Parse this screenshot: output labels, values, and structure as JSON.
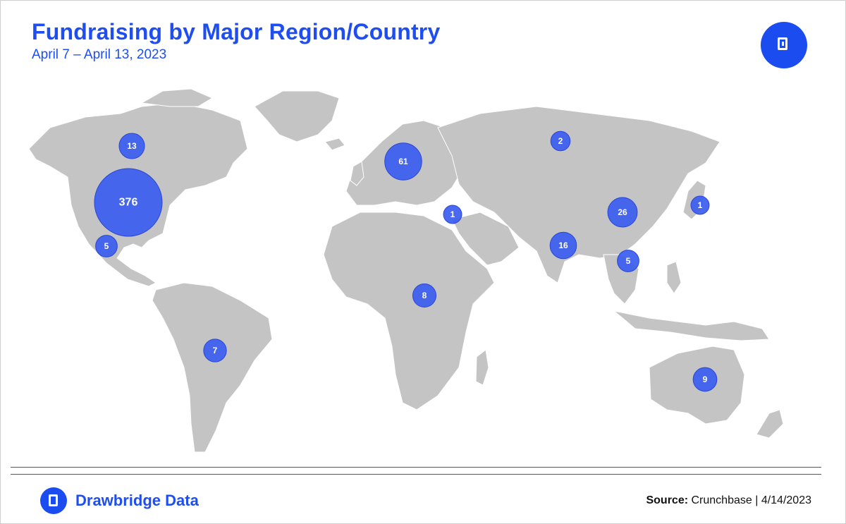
{
  "header": {
    "title": "Fundraising by Major Region/Country",
    "subtitle": "April 7 – April 13, 2023"
  },
  "footer": {
    "brand": "Drawbridge Data",
    "source_label": "Source:",
    "source_text": " Crunchbase | 4/14/2023"
  },
  "colors": {
    "accent": "#1f4ef0",
    "land": "#c4c4c4",
    "bubble": "#3b5cf0"
  },
  "icons": {
    "corner": "drawbridge-logo-icon",
    "brand": "drawbridge-logo-icon"
  },
  "map_data": {
    "type": "bubble-map",
    "bubbles": [
      {
        "region": "Canada",
        "value": 13
      },
      {
        "region": "United States",
        "value": 376
      },
      {
        "region": "Mexico",
        "value": 5
      },
      {
        "region": "Brazil",
        "value": 7
      },
      {
        "region": "Europe",
        "value": 61
      },
      {
        "region": "Russia",
        "value": 2
      },
      {
        "region": "Israel",
        "value": 1
      },
      {
        "region": "Africa",
        "value": 8
      },
      {
        "region": "India",
        "value": 16
      },
      {
        "region": "China",
        "value": 26
      },
      {
        "region": "Japan",
        "value": 1
      },
      {
        "region": "Southeast Asia",
        "value": 5
      },
      {
        "region": "Australia",
        "value": 9
      }
    ]
  }
}
